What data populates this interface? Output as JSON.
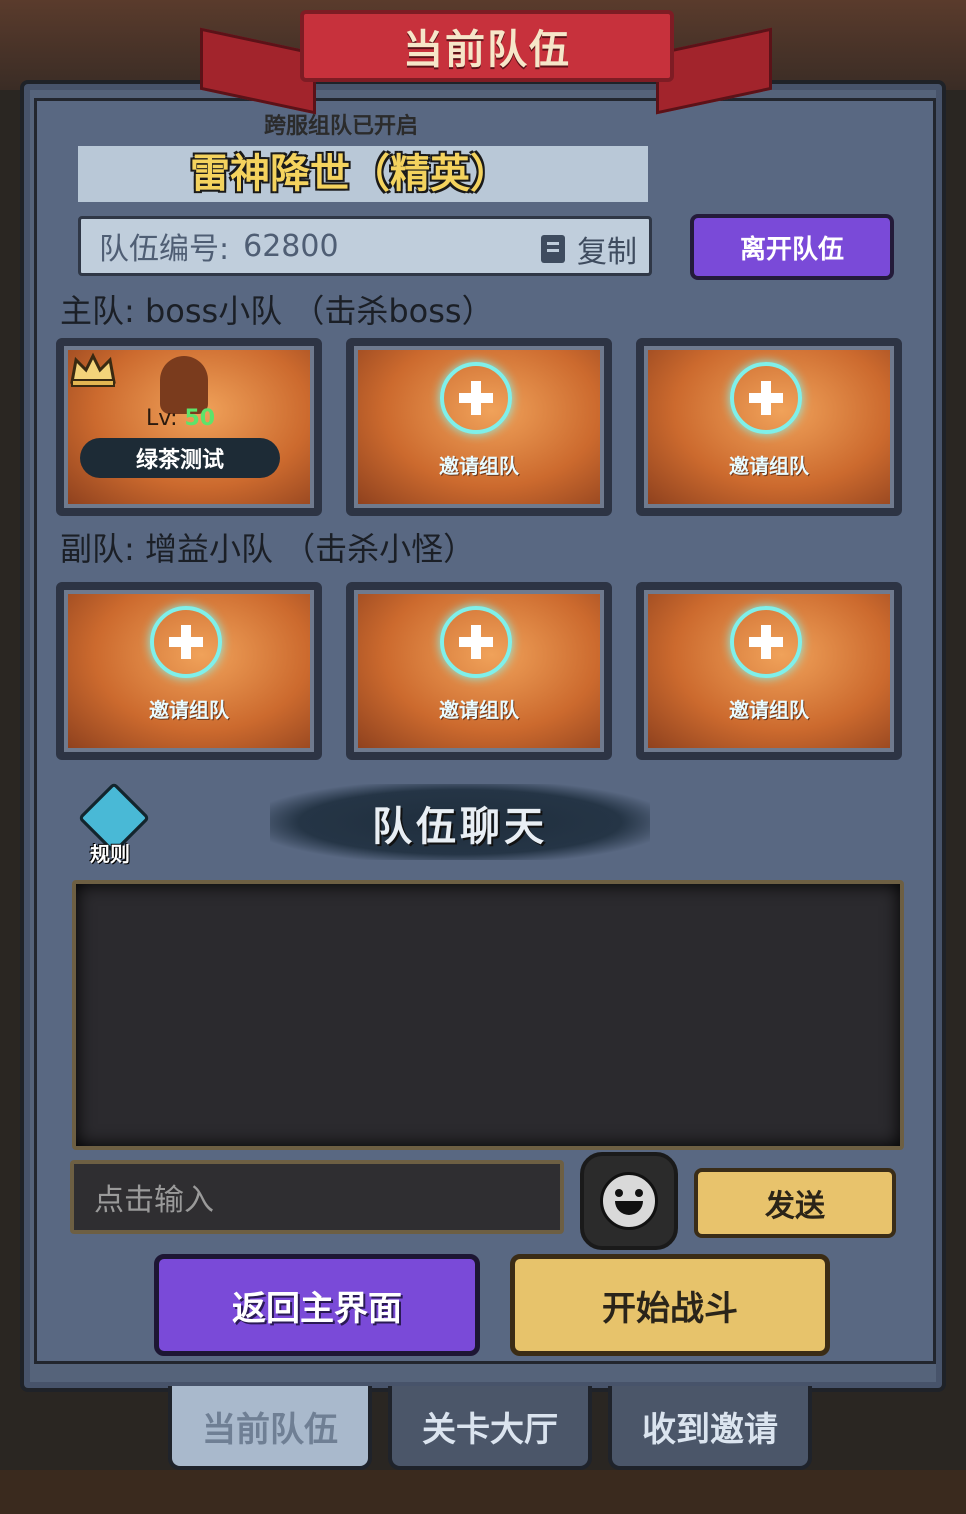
{
  "header": {
    "title": "当前队伍"
  },
  "team_info": {
    "cross_server_notice": "跨服组队已开启",
    "stage_name": "雷神降世（精英）",
    "team_id_label": "队伍编号:",
    "team_id_value": "62800",
    "copy_label": "复制",
    "leave_label": "离开队伍"
  },
  "main_team": {
    "label": "主队:  boss小队  （击杀boss）",
    "leader": {
      "level_prefix": "Lv:",
      "level": "50",
      "name": "绿茶测试"
    },
    "invite_label": "邀请组队"
  },
  "sub_team": {
    "label": "副队:  增益小队  （击杀小怪）",
    "invite_label": "邀请组队"
  },
  "rules": {
    "label": "规则"
  },
  "chat": {
    "title": "队伍聊天",
    "input_placeholder": "点击输入",
    "send_label": "发送"
  },
  "actions": {
    "back_label": "返回主界面",
    "start_label": "开始战斗"
  },
  "tabs": [
    {
      "label": "当前队伍",
      "active": true
    },
    {
      "label": "关卡大厅",
      "active": false
    },
    {
      "label": "收到邀请",
      "active": false
    }
  ],
  "icons": [
    "copy-icon",
    "crown-icon",
    "plus-icon",
    "rules-icon",
    "emoji-icon"
  ],
  "colors": {
    "purple": "#7a4ad8",
    "gold": "#e7c36b",
    "red": "#c7313c",
    "panel": "#596882"
  }
}
